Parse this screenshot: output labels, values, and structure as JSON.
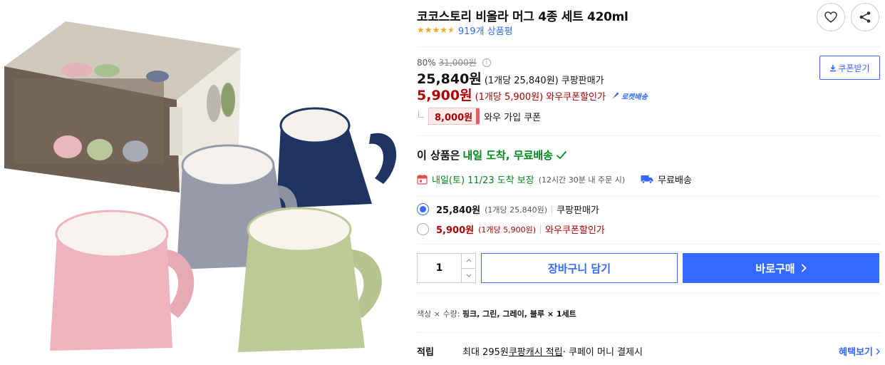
{
  "product": {
    "title": "코코스토리 비올라 머그 4종 세트 420ml",
    "rating_value": 4.5,
    "review_count": "919개 상품평",
    "image_alt": "코코스토리 비올라 머그 4P 세트"
  },
  "price": {
    "discount_rate": "80%",
    "original_price": "31,000원",
    "sale_price": "25,840원",
    "sale_unit": "(1개당 25,840원)",
    "sale_label": "쿠팡판매가",
    "wow_price": "5,900원",
    "wow_unit": "(1개당 5,900원)",
    "wow_label": "와우쿠폰할인가",
    "rocket_badge": "로켓배송",
    "coupon_button": "쿠폰받기",
    "member_coupon_amount": "8,000원",
    "member_coupon_text": "와우 가입 쿠폰"
  },
  "delivery": {
    "headline_prefix": "이 상품은 ",
    "headline_highlight": "내일 도착, 무료배송",
    "arrival_text": "내일(토) 11/23 도착 보장",
    "arrival_note": "(12시간 30분 내 주문 시)",
    "shipping_text": "무료배송"
  },
  "options": [
    {
      "price": "25,840원",
      "unit": "(1개당 25,840원)",
      "label": "쿠팡판매가",
      "selected": true
    },
    {
      "price": "5,900원",
      "unit": "(1개당 5,900원)",
      "label": "와우쿠폰할인가",
      "selected": false
    }
  ],
  "purchase": {
    "quantity": "1",
    "cart_button": "장바구니 담기",
    "buy_button": "바로구매"
  },
  "option_summary": {
    "label": "색상 × 수량: ",
    "value": "핑크, 그린, 그레이, 블루 × 1세트"
  },
  "reward": {
    "label": "적립",
    "text_prefix": "최대 295원 ",
    "link_text": "쿠팡캐시 적립",
    "text_suffix": " · 쿠페이 머니 결제시",
    "benefit_link": "혜택보기"
  },
  "colors": {
    "accent_blue": "#346aff",
    "wow_red": "#ae0000",
    "delivery_green": "#00891a",
    "star": "#f5a623"
  },
  "icons": [
    "heart-icon",
    "share-icon",
    "info-icon",
    "download-icon",
    "rocket-icon",
    "check-icon",
    "calendar-icon",
    "truck-icon",
    "chevron-up-icon",
    "chevron-down-icon",
    "chevron-right-icon"
  ]
}
